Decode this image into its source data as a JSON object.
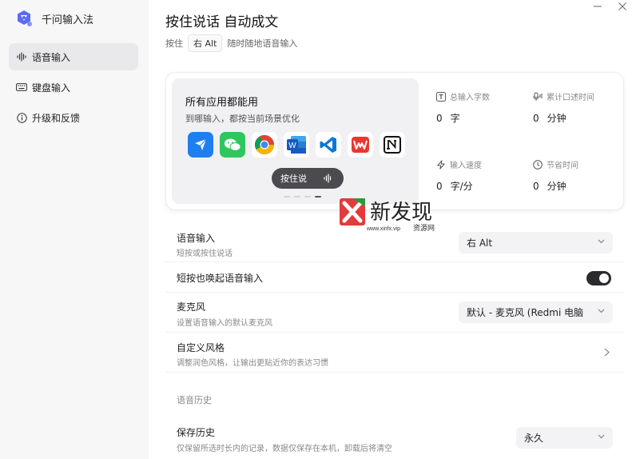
{
  "app": {
    "name": "千问输入法",
    "accent": "#5b6cf0"
  },
  "sidebar": {
    "items": [
      {
        "label": "语音输入",
        "icon": "waveform-icon",
        "active": true
      },
      {
        "label": "键盘输入",
        "icon": "keyboard-icon",
        "active": false
      },
      {
        "label": "升级和反馈",
        "icon": "info-icon",
        "active": false
      }
    ]
  },
  "header": {
    "title": "按住说话 自动成文",
    "subtitle_prefix": "按住",
    "subtitle_key": "右 Alt",
    "subtitle_suffix": "随时随地语音输入"
  },
  "hero": {
    "title": "所有应用都能用",
    "desc": "到哪输入，都按当前场景优化",
    "apps": [
      "feishu-icon",
      "wechat-icon",
      "chrome-icon",
      "word-icon",
      "vscode-icon",
      "wps-icon",
      "notion-icon"
    ],
    "push_to_talk": "按住说",
    "carousel_active_index": 3
  },
  "stats": [
    {
      "label": "总输入字数",
      "icon": "text-icon",
      "value": "0",
      "unit": "字"
    },
    {
      "label": "累计口述时间",
      "icon": "mic-icon",
      "value": "0",
      "unit": "分钟"
    },
    {
      "label": "输入速度",
      "icon": "lightning-icon",
      "value": "0",
      "unit": "字/分"
    },
    {
      "label": "节省时间",
      "icon": "clock-icon",
      "value": "0",
      "unit": "分钟"
    }
  ],
  "watermark": {
    "big": "新发现",
    "url": "www.xinfx.vip",
    "small": "资源网"
  },
  "settings": {
    "voice_input": {
      "title": "语音输入",
      "desc": "短按或按住说话",
      "value": "右 Alt"
    },
    "short_press": {
      "title": "短按也唤起语音输入",
      "enabled": true
    },
    "microphone": {
      "title": "麦克风",
      "desc": "设置语音输入的默认麦克风",
      "value": "默认 - 麦克风 (Redmi 电脑"
    },
    "custom_style": {
      "title": "自定义风格",
      "desc": "调整润色风格，让输出更贴近你的表达习惯"
    },
    "history_section": "语音历史",
    "save_history": {
      "title": "保存历史",
      "desc": "仅保留所选时长内的记录，数据仅保存在本机，卸载后将清空",
      "value": "永久"
    }
  }
}
